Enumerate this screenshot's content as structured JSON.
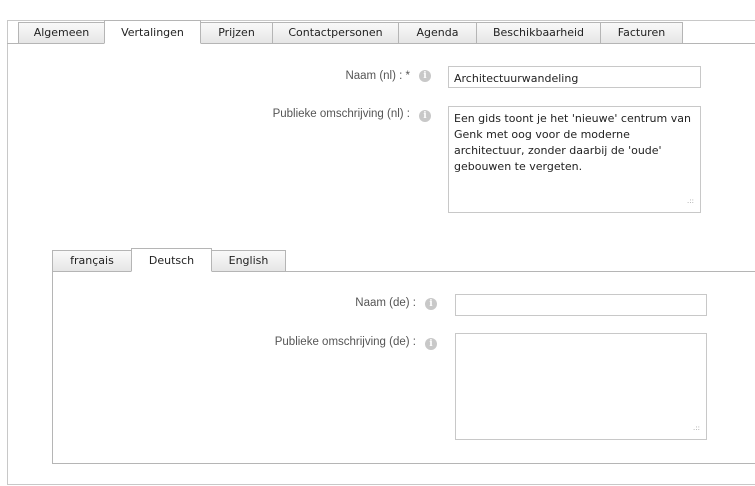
{
  "tabs": [
    "Algemeen",
    "Vertalingen",
    "Prijzen",
    "Contactpersonen",
    "Agenda",
    "Beschikbaarheid",
    "Facturen"
  ],
  "active_tab": "Vertalingen",
  "nl": {
    "name_label": "Naam (nl) : *",
    "name_value": "Architectuurwandeling",
    "desc_label": "Publieke omschrijving (nl) :",
    "desc_value": "Een gids toont je het 'nieuwe' centrum van Genk met oog voor de moderne architectuur, zonder daarbij de 'oude' gebouwen te vergeten."
  },
  "language_tabs": [
    "français",
    "Deutsch",
    "English"
  ],
  "active_language_tab": "Deutsch",
  "de": {
    "name_label": "Naam (de) :",
    "name_value": "",
    "desc_label": "Publieke omschrijving (de) :",
    "desc_value": ""
  },
  "icons": {
    "info": "info-icon",
    "resize": "resize-grip-icon"
  }
}
